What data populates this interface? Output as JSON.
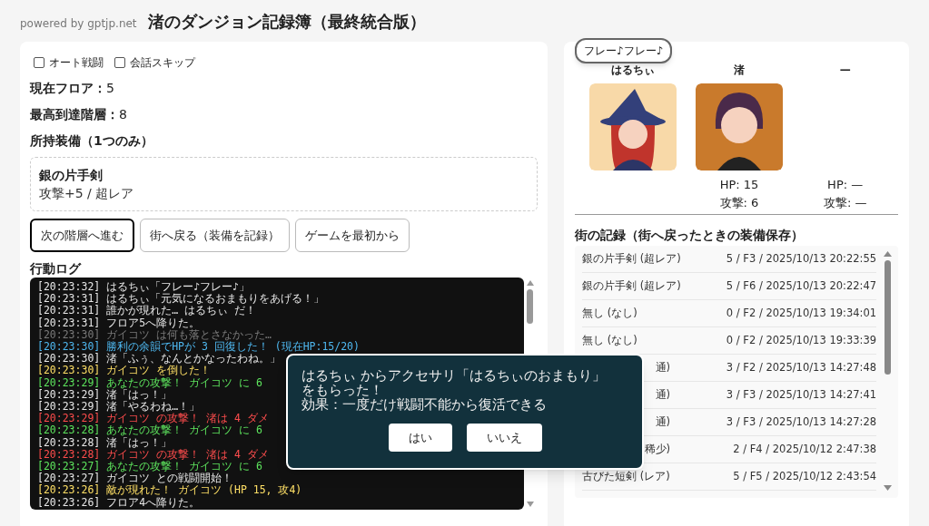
{
  "header": {
    "powered_by": "powered by gptjp.net",
    "title": "渚のダンジョン記録簿（最終統合版）"
  },
  "options": [
    {
      "label": "オート戦闘",
      "checked": false
    },
    {
      "label": "会話スキップ",
      "checked": false
    }
  ],
  "stats": [
    {
      "label": "現在フロア：",
      "value": "5"
    },
    {
      "label": "最高到達階層：",
      "value": "8"
    }
  ],
  "equipment": {
    "heading": "所持装備（1つのみ）",
    "name": "銀の片手剣",
    "detail": "攻撃+5 / 超レア"
  },
  "buttons": [
    {
      "label": "次の階層へ進む",
      "focused": true
    },
    {
      "label": "街へ戻る（装備を記録）",
      "focused": false
    },
    {
      "label": "ゲームを最初から",
      "focused": false
    }
  ],
  "log": {
    "heading": "行動ログ",
    "lines": [
      {
        "time": "[20:23:32]",
        "text": "はるちぃ「フレー♪フレー♪」",
        "color": "#e8e8e8"
      },
      {
        "time": "[20:23:31]",
        "text": "はるちぃ「元気になるおまもりをあげる！」",
        "color": "#e8e8e8"
      },
      {
        "time": "[20:23:31]",
        "text": "誰かが現れた… はるちぃ だ！",
        "color": "#e8e8e8"
      },
      {
        "time": "[20:23:31]",
        "text": "フロア5へ降りた。",
        "color": "#e8e8e8"
      },
      {
        "time": "[20:23:30]",
        "text": "ガイコツ は何も落とさなかった…",
        "color": "#7a7a7a"
      },
      {
        "time": "[20:23:30]",
        "text": "勝利の余韻でHPが 3 回復した！ (現在HP:15/20)",
        "color": "#4fb8f0"
      },
      {
        "time": "[20:23:30]",
        "text": "渚「ふぅ、なんとかなったわね。」",
        "color": "#e8e8e8"
      },
      {
        "time": "[20:23:30]",
        "text": "ガイコツ を倒した！",
        "color": "#ffe066"
      },
      {
        "time": "[20:23:29]",
        "text": "あなたの攻撃！ ガイコツ に 6",
        "color": "#5ee65e"
      },
      {
        "time": "[20:23:29]",
        "text": "渚「はっ！」",
        "color": "#e8e8e8"
      },
      {
        "time": "[20:23:29]",
        "text": "渚「やるわね…！」",
        "color": "#e8e8e8"
      },
      {
        "time": "[20:23:29]",
        "text": "ガイコツ の攻撃！ 渚は 4 ダメ",
        "color": "#ff4d4d"
      },
      {
        "time": "[20:23:28]",
        "text": "あなたの攻撃！ ガイコツ に 6",
        "color": "#5ee65e"
      },
      {
        "time": "[20:23:28]",
        "text": "渚「はっ！」",
        "color": "#e8e8e8"
      },
      {
        "time": "[20:23:28]",
        "text": "ガイコツ の攻撃！ 渚は 4 ダメ",
        "color": "#ff4d4d"
      },
      {
        "time": "[20:23:27]",
        "text": "あなたの攻撃！ ガイコツ に 6",
        "color": "#5ee65e"
      },
      {
        "time": "[20:23:27]",
        "text": "ガイコツ との戦闘開始！",
        "color": "#e8e8e8"
      },
      {
        "time": "[20:23:26]",
        "text": "敵が現れた！ ガイコツ (HP 15, 攻4)",
        "color": "#ffe066"
      },
      {
        "time": "[20:23:26]",
        "text": "フロア4へ降りた。",
        "color": "#e8e8e8"
      }
    ]
  },
  "party": [
    {
      "name": "はるちぃ",
      "speech": "フレー♪フレー♪",
      "kind": "witch"
    },
    {
      "name": "渚",
      "kind": "girl",
      "hp": "HP: 15",
      "attack": "攻撃: 6"
    },
    {
      "name": "—",
      "kind": "empty",
      "hp": "HP: —",
      "attack": "攻撃: —"
    }
  ],
  "town_records": {
    "heading": "街の記録（街へ戻ったときの装備保存）",
    "rows": [
      {
        "item": "銀の片手剣 (超レア)",
        "info": "5 / F3 / 2025/10/13 20:22:55",
        "covered": false
      },
      {
        "item": "銀の片手剣 (超レア)",
        "info": "5 / F6 / 2025/10/13 20:22:47",
        "covered": false
      },
      {
        "item": "無し (なし)",
        "info": "0 / F2 / 2025/10/13 19:34:01",
        "covered": false
      },
      {
        "item": "無し (なし)",
        "info": "0 / F2 / 2025/10/13 19:33:39",
        "covered": false
      },
      {
        "item": "通)",
        "info": "3 / F2 / 2025/10/13 14:27:48",
        "covered": true
      },
      {
        "item": "通)",
        "info": "3 / F3 / 2025/10/13 14:27:41",
        "covered": true
      },
      {
        "item": "通)",
        "info": "3 / F3 / 2025/10/13 14:27:28",
        "covered": true
      },
      {
        "item": "稀少)",
        "info": "2 / F4 / 2025/10/12 2:47:38",
        "covered": true
      },
      {
        "item": "古びた短剣 (レア)",
        "info": "5 / F5 / 2025/10/12 2:43:54",
        "covered": false
      }
    ]
  },
  "dialog": {
    "message": "はるちぃ からアクセサリ「はるちぃのおまもり」をもらった！",
    "effect": "効果：一度だけ戦闘不能から復活できる",
    "buttons": [
      "はい",
      "いいえ"
    ]
  }
}
